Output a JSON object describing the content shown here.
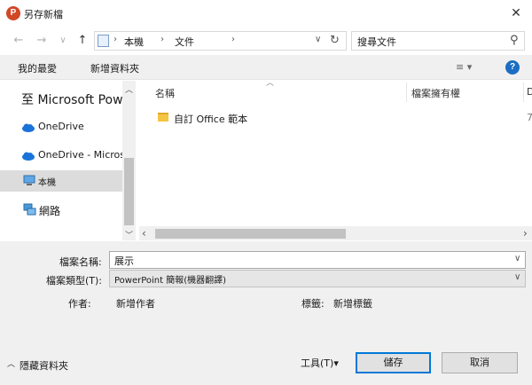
{
  "window": {
    "title": "另存新檔",
    "app_icon_letter": "P",
    "close_glyph": "✕"
  },
  "nav": {
    "back": "←",
    "forward": "→",
    "dropdown": "∨",
    "up": "↑",
    "breadcrumb": [
      "本機",
      "文件"
    ],
    "breadcrumb_sep": "›",
    "address_dropdown": "∨",
    "refresh": "↻",
    "search_placeholder": "搜尋文件",
    "search_icon": "⚲"
  },
  "toolbar": {
    "organize": "我的最愛",
    "new_folder": "新增資料夾",
    "view_icon": "≡ ▾",
    "help": "?"
  },
  "sidebar": {
    "items": [
      {
        "label": "至 Microsoft PowerPC",
        "icon": "none"
      },
      {
        "label": "OneDrive",
        "icon": "cloud-icon"
      },
      {
        "label": "OneDrive - Micros",
        "icon": "cloud-icon"
      },
      {
        "label": "本機",
        "icon": "computer-icon"
      },
      {
        "label": "網路",
        "icon": "network-icon"
      }
    ],
    "scroll_up": "︿",
    "scroll_down": "﹀"
  },
  "files": {
    "columns": [
      "名稱",
      "檔案擁有權",
      "D"
    ],
    "sort_glyph": "︿",
    "partial_col_value": "7",
    "rows": [
      {
        "name": "自訂 Office 範本"
      }
    ],
    "scroll_left": "‹",
    "scroll_right": "›"
  },
  "form": {
    "filename_label": "檔案名稱:",
    "filename_value": "展示",
    "filetype_label": "檔案類型(T):",
    "filetype_value": "PowerPoint 簡報(機器翻譯)",
    "author_label": "作者:",
    "author_value": "新增作者",
    "tags_label": "標籤:",
    "tags_value": "新增標籤",
    "dropdown_glyph": "∨"
  },
  "footer": {
    "hide_folders": "隱藏資料夾",
    "hide_glyph": "︿",
    "tools": "工具(T)",
    "tools_glyph": "▾",
    "save": "儲存",
    "cancel": "取消"
  }
}
